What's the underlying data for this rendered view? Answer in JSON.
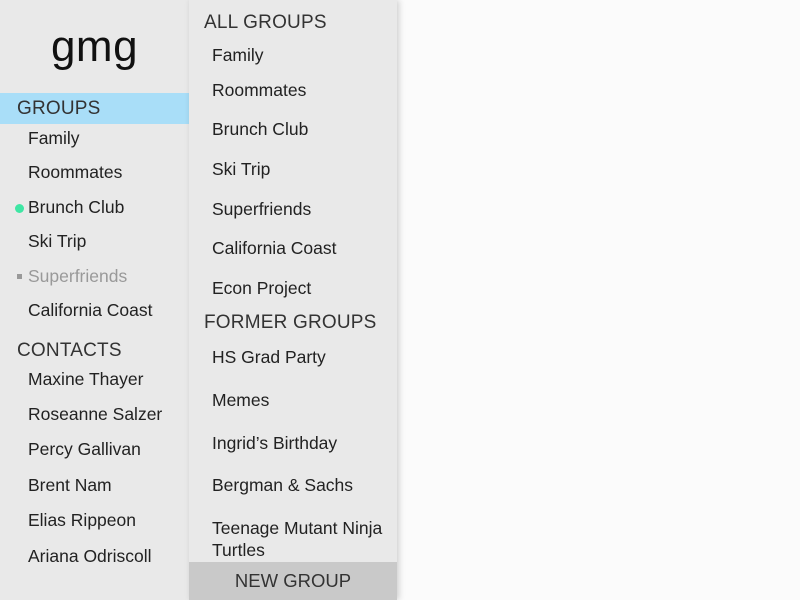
{
  "app": {
    "logo": "gmg"
  },
  "sidebar": {
    "groups_header": "GROUPS",
    "groups": [
      {
        "label": "Family",
        "status": "none"
      },
      {
        "label": "Roommates",
        "status": "none"
      },
      {
        "label": "Brunch Club",
        "status": "online"
      },
      {
        "label": "Ski Trip",
        "status": "none"
      },
      {
        "label": "Superfriends",
        "status": "muted"
      },
      {
        "label": "California Coast",
        "status": "none"
      }
    ],
    "contacts_header": "CONTACTS",
    "contacts": [
      {
        "label": "Maxine Thayer"
      },
      {
        "label": "Roseanne Salzer"
      },
      {
        "label": "Percy Gallivan"
      },
      {
        "label": "Brent Nam"
      },
      {
        "label": "Elias Rippeon"
      },
      {
        "label": "Ariana Odriscoll"
      }
    ]
  },
  "panel": {
    "all_groups_header": "ALL GROUPS",
    "all_groups": [
      {
        "label": "Family"
      },
      {
        "label": "Roommates"
      },
      {
        "label": "Brunch Club"
      },
      {
        "label": "Ski Trip"
      },
      {
        "label": "Superfriends"
      },
      {
        "label": "California Coast"
      },
      {
        "label": "Econ Project"
      }
    ],
    "former_groups_header": "FORMER GROUPS",
    "former_groups": [
      {
        "label": "HS Grad Party"
      },
      {
        "label": "Memes"
      },
      {
        "label": "Ingrid’s Birthday"
      },
      {
        "label": "Bergman & Sachs"
      },
      {
        "label": "Teenage Mutant Ninja Turtles"
      }
    ],
    "new_group_button": "NEW GROUP"
  },
  "colors": {
    "active_highlight": "#a9def8",
    "online_dot": "#3fe6a4",
    "muted_text": "#999999",
    "panel_background": "#e9e9e9",
    "button_background": "#c9c9c9"
  }
}
